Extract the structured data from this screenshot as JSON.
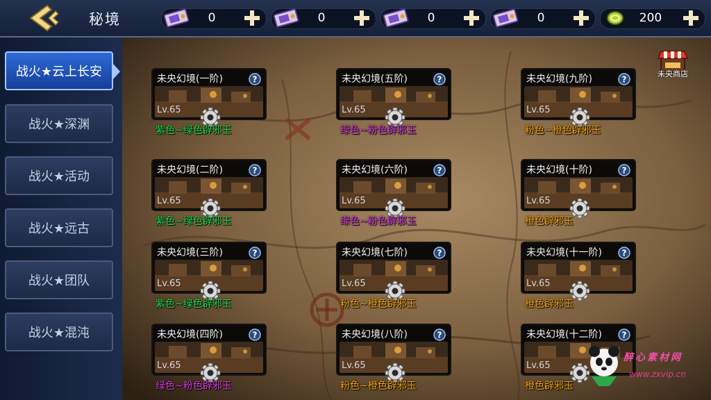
{
  "header": {
    "title": "秘境",
    "resources": [
      {
        "icon": "ticket-icon",
        "value": "0"
      },
      {
        "icon": "ticket-icon",
        "value": "0"
      },
      {
        "icon": "ticket-icon",
        "value": "0"
      },
      {
        "icon": "ticket-icon",
        "value": "0"
      },
      {
        "icon": "coin-icon",
        "value": "200"
      }
    ]
  },
  "sidebar": {
    "items": [
      {
        "label": "战火★云上长安",
        "active": true
      },
      {
        "label": "战火★深渊"
      },
      {
        "label": "战火★活动"
      },
      {
        "label": "战火★远古"
      },
      {
        "label": "战火★团队"
      },
      {
        "label": "战火★混沌"
      }
    ]
  },
  "shop": {
    "label": "未央商店"
  },
  "cards": [
    {
      "title": "未央幻境(一阶)",
      "level": "Lv.65",
      "reward": "紫色~绿色辟邪玉",
      "reward_color": "#21d84a"
    },
    {
      "title": "未央幻境(五阶)",
      "level": "Lv.65",
      "reward": "绿色~粉色辟邪玉",
      "reward_color": "#d43ad8"
    },
    {
      "title": "未央幻境(九阶)",
      "level": "Lv.65",
      "reward": "粉色~橙色辟邪玉",
      "reward_color": "#f0a318"
    },
    {
      "title": "未央幻境(二阶)",
      "level": "Lv.65",
      "reward": "紫色~绿色辟邪玉",
      "reward_color": "#21d84a"
    },
    {
      "title": "未央幻境(六阶)",
      "level": "Lv.65",
      "reward": "绿色~粉色辟邪玉",
      "reward_color": "#d43ad8"
    },
    {
      "title": "未央幻境(十阶)",
      "level": "Lv.65",
      "reward": "橙色辟邪玉",
      "reward_color": "#f0a318"
    },
    {
      "title": "未央幻境(三阶)",
      "level": "Lv.65",
      "reward": "紫色~绿色辟邪玉",
      "reward_color": "#21d84a"
    },
    {
      "title": "未央幻境(七阶)",
      "level": "Lv.65",
      "reward": "粉色~橙色辟邪玉",
      "reward_color": "#f0a318"
    },
    {
      "title": "未央幻境(十一阶)",
      "level": "Lv.65",
      "reward": "橙色辟邪玉",
      "reward_color": "#f0a318"
    },
    {
      "title": "未央幻境(四阶)",
      "level": "Lv.65",
      "reward": "绿色~粉色辟邪玉",
      "reward_color": "#d43ad8"
    },
    {
      "title": "未央幻境(八阶)",
      "level": "Lv.65",
      "reward": "粉色~橙色辟邪玉",
      "reward_color": "#f0a318"
    },
    {
      "title": "未央幻境(十二阶)",
      "level": "Lv.65",
      "reward": "橙色辟邪玉",
      "reward_color": "#f0a318"
    }
  ],
  "watermark": {
    "title": "醉心素材网",
    "url": "www.zxvip.cn"
  }
}
